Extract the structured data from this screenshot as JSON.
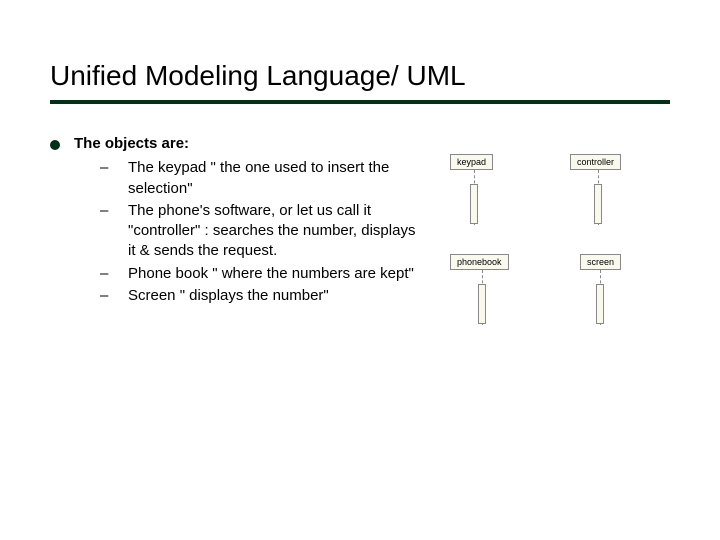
{
  "title": "Unified Modeling Language/ UML",
  "lead": "The objects are:",
  "items": [
    "The keypad \" the one used to insert the selection\"",
    "The phone's software, or let us call it \"controller\" : searches the number, displays it & sends the request.",
    "Phone book \" where the numbers are kept\"",
    "Screen \" displays the number\""
  ],
  "diagram": {
    "keypad": "keypad",
    "controller": "controller",
    "phonebook": "phonebook",
    "screen": "screen"
  }
}
